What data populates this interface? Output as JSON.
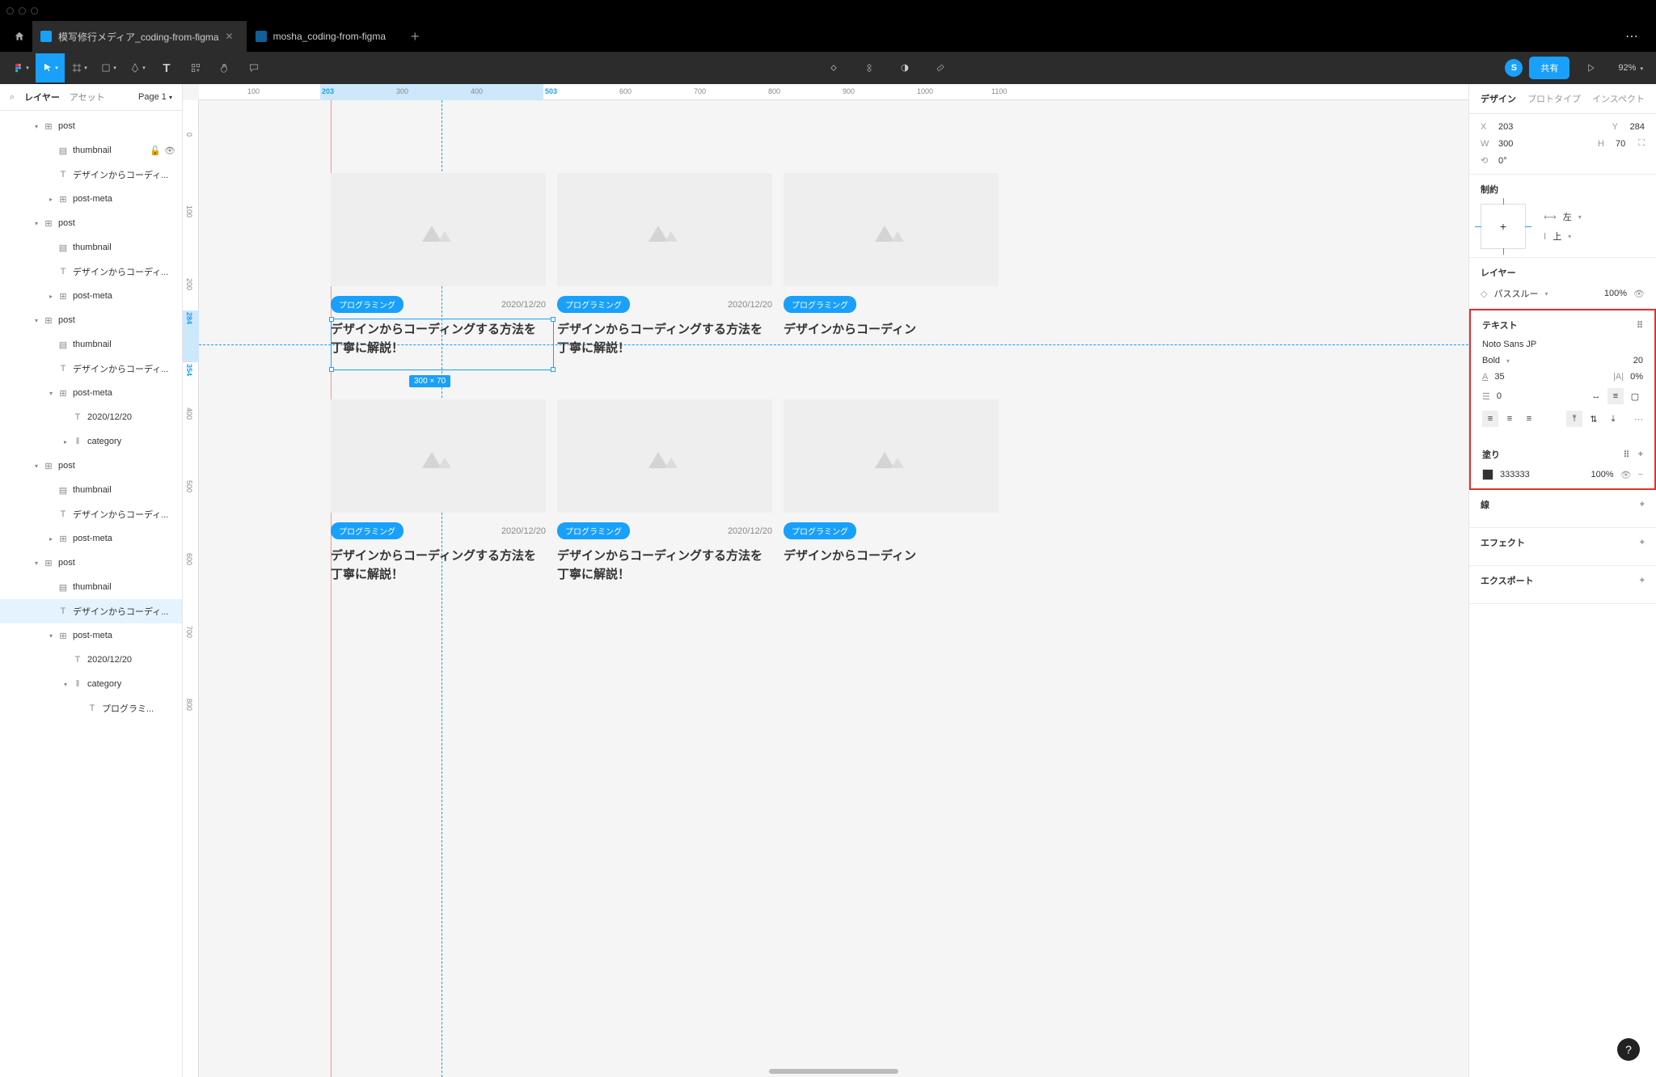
{
  "tabs": {
    "active": "模写修行メディア_coding-from-figma",
    "inactive": "mosha_coding-from-figma"
  },
  "toolbar": {
    "avatar_letter": "S",
    "share_label": "共有",
    "zoom": "92%"
  },
  "left_panel": {
    "tab_layers": "レイヤー",
    "tab_assets": "アセット",
    "page_label": "Page 1",
    "layers": [
      {
        "depth": 1,
        "caret": "▾",
        "icon": "frame",
        "name": "post"
      },
      {
        "depth": 2,
        "caret": "",
        "icon": "image",
        "name": "thumbnail",
        "actions": true
      },
      {
        "depth": 2,
        "caret": "",
        "icon": "text",
        "name": "デザインからコーディ..."
      },
      {
        "depth": 2,
        "caret": "▸",
        "icon": "frame",
        "name": "post-meta"
      },
      {
        "depth": 1,
        "caret": "▾",
        "icon": "frame",
        "name": "post"
      },
      {
        "depth": 2,
        "caret": "",
        "icon": "image",
        "name": "thumbnail"
      },
      {
        "depth": 2,
        "caret": "",
        "icon": "text",
        "name": "デザインからコーディ..."
      },
      {
        "depth": 2,
        "caret": "▸",
        "icon": "frame",
        "name": "post-meta"
      },
      {
        "depth": 1,
        "caret": "▾",
        "icon": "frame",
        "name": "post"
      },
      {
        "depth": 2,
        "caret": "",
        "icon": "image",
        "name": "thumbnail"
      },
      {
        "depth": 2,
        "caret": "",
        "icon": "text",
        "name": "デザインからコーディ..."
      },
      {
        "depth": 2,
        "caret": "▾",
        "icon": "frame",
        "name": "post-meta"
      },
      {
        "depth": 3,
        "caret": "",
        "icon": "text",
        "name": "2020/12/20"
      },
      {
        "depth": 3,
        "caret": "▸",
        "icon": "group",
        "name": "category"
      },
      {
        "depth": 1,
        "caret": "▾",
        "icon": "frame",
        "name": "post"
      },
      {
        "depth": 2,
        "caret": "",
        "icon": "image",
        "name": "thumbnail"
      },
      {
        "depth": 2,
        "caret": "",
        "icon": "text",
        "name": "デザインからコーディ..."
      },
      {
        "depth": 2,
        "caret": "▸",
        "icon": "frame",
        "name": "post-meta"
      },
      {
        "depth": 1,
        "caret": "▾",
        "icon": "frame",
        "name": "post"
      },
      {
        "depth": 2,
        "caret": "",
        "icon": "image",
        "name": "thumbnail"
      },
      {
        "depth": 2,
        "caret": "",
        "icon": "text",
        "name": "デザインからコーディ...",
        "selected": true
      },
      {
        "depth": 2,
        "caret": "▾",
        "icon": "frame",
        "name": "post-meta"
      },
      {
        "depth": 3,
        "caret": "",
        "icon": "text",
        "name": "2020/12/20"
      },
      {
        "depth": 3,
        "caret": "▾",
        "icon": "group",
        "name": "category"
      },
      {
        "depth": 4,
        "caret": "",
        "icon": "text",
        "name": "プログラミ..."
      }
    ]
  },
  "canvas": {
    "ruler_h": [
      "100",
      "203",
      "300",
      "400",
      "503",
      "600",
      "700",
      "800",
      "900",
      "1000",
      "1100"
    ],
    "ruler_h_active": [
      "203",
      "503"
    ],
    "ruler_v": [
      "0",
      "100",
      "200",
      "284",
      "354",
      "400",
      "500",
      "600",
      "700",
      "800"
    ],
    "ruler_v_active": [
      "284",
      "354"
    ],
    "selection_size": "300 × 70",
    "card": {
      "badge": "プログラミング",
      "date": "2020/12/20",
      "title": "デザインからコーディングする方法を丁寧に解説！"
    },
    "card_partial_title": "デザインからコーディン"
  },
  "right_panel": {
    "tabs": {
      "design": "デザイン",
      "prototype": "プロトタイプ",
      "inspect": "インスペクト"
    },
    "position": {
      "x_label": "X",
      "x": "203",
      "y_label": "Y",
      "y": "284",
      "w_label": "W",
      "w": "300",
      "h_label": "H",
      "h": "70",
      "rot_label": "⟲",
      "rot": "0°"
    },
    "constraints": {
      "title": "制約",
      "h_label": "左",
      "v_label": "上"
    },
    "layer": {
      "title": "レイヤー",
      "mode": "パススルー",
      "opacity": "100%"
    },
    "text": {
      "title": "テキスト",
      "font": "Noto Sans JP",
      "weight": "Bold",
      "size": "20",
      "line_height": "35",
      "letter_spacing": "0%",
      "paragraph": "0"
    },
    "fill": {
      "title": "塗り",
      "hex": "333333",
      "opacity": "100%"
    },
    "stroke": {
      "title": "線"
    },
    "effects": {
      "title": "エフェクト"
    },
    "export": {
      "title": "エクスポート"
    }
  }
}
